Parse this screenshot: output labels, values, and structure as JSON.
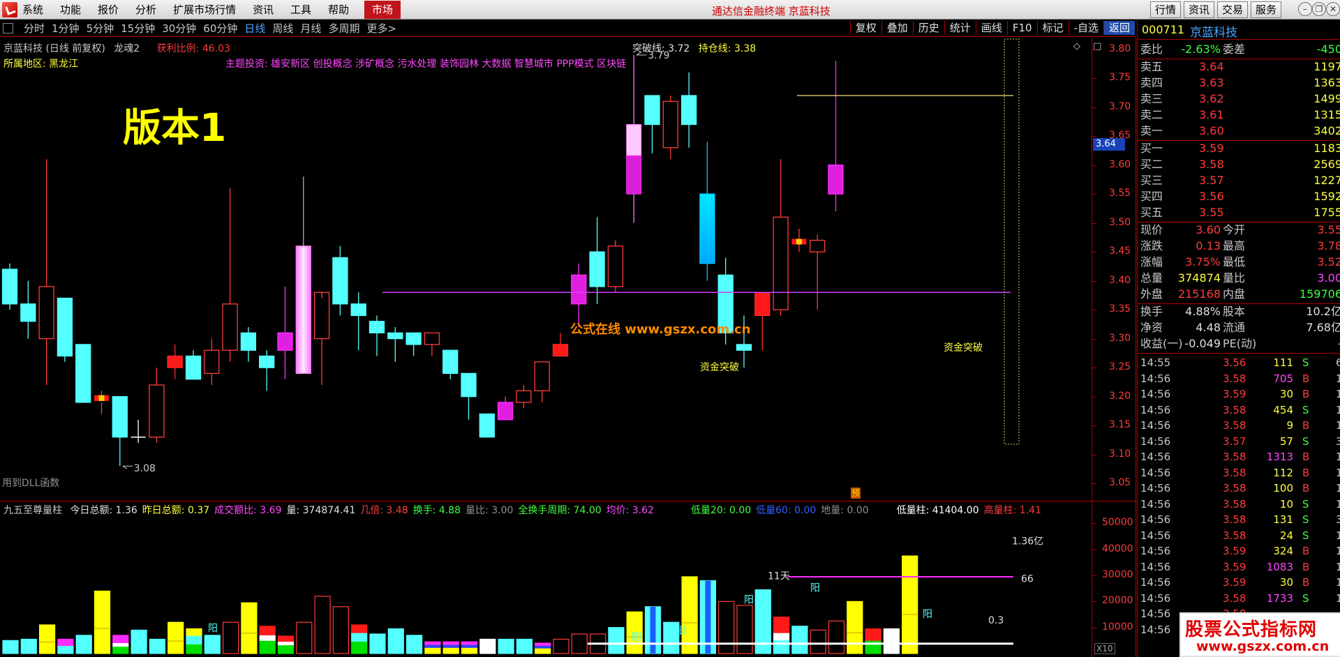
{
  "menubar": {
    "items": [
      "系统",
      "功能",
      "报价",
      "分析",
      "扩展市场行情",
      "资讯",
      "工具",
      "帮助"
    ],
    "market_tab": "市场",
    "banner": "通达信金融终端  京蓝科技",
    "right_buttons": [
      "行情",
      "资讯",
      "交易",
      "服务"
    ]
  },
  "periodbar": {
    "periods": [
      "分时",
      "1分钟",
      "5分钟",
      "15分钟",
      "30分钟",
      "60分钟",
      "日线",
      "周线",
      "月线",
      "多周期",
      "更多>"
    ],
    "active": "日线",
    "tools": [
      "复权",
      "叠加",
      "历史",
      "统计",
      "画线",
      "F10",
      "标记",
      "-自选",
      "返回"
    ]
  },
  "main": {
    "stock_info": "京蓝科技 (日线 前复权)",
    "indicator_name": "龙魂2",
    "profit_label": "获利比例: 46.03",
    "breakthrough_label": "突破线: 3.72",
    "hold_label": "持仓线: 3.38",
    "region": "所属地区: 黑龙江",
    "theme": "主题投资: 雄安新区 创投概念 涉矿概念 污水处理 装饰园林 大数据 智慧城市 PPP模式 区块链",
    "version": "版本1",
    "watermark": "公式在线  www.gszx.com.cn",
    "dll_label": "用到DLL函数",
    "annotation1": "资金突破",
    "annotation2": "资金突破",
    "pre_marker": "预",
    "current_price_tag": "3.64",
    "high_label": "3.79",
    "low_label": "3.08",
    "price_axis": [
      "3.80",
      "3.75",
      "3.70",
      "3.65",
      "3.60",
      "3.55",
      "3.50",
      "3.45",
      "3.40",
      "3.35",
      "3.30",
      "3.25",
      "3.20",
      "3.15",
      "3.10",
      "3.05"
    ]
  },
  "volume": {
    "title": "九五至尊量柱",
    "fields": [
      {
        "label": "今日总额: 1.36",
        "color": "#e0e0e0"
      },
      {
        "label": "昨日总额: 0.37",
        "color": "#ffff40"
      },
      {
        "label": "成交额比: 3.69",
        "color": "#ff4aff"
      },
      {
        "label": "量: 374874.41",
        "color": "#e0e0e0"
      },
      {
        "label": "几倍: 3.48",
        "color": "#ff3c3c"
      },
      {
        "label": "换手: 4.88",
        "color": "#40ff40"
      },
      {
        "label": "量比: 3.00",
        "color": "#909090"
      },
      {
        "label": "全换手周期: 74.00",
        "color": "#40ff40"
      },
      {
        "label": "均价: 3.62",
        "color": "#ff4aff"
      }
    ],
    "fields_right": [
      {
        "label": "低量20: 0.00",
        "color": "#40ff40"
      },
      {
        "label": "低量60: 0.00",
        "color": "#3060ff"
      },
      {
        "label": "地量: 0.00",
        "color": "#909090"
      },
      {
        "label": "低量柱: 41404.00",
        "color": "#ffffff"
      },
      {
        "label": "高量柱: 1.41",
        "color": "#ff3c3c"
      }
    ],
    "axis": [
      "50000",
      "40000",
      "30000",
      "20000",
      "10000"
    ],
    "top_label": "1.36亿",
    "label_66": "66",
    "label_11": "11天",
    "label_03": "0.3",
    "yang_label": "阳",
    "x10": "X10"
  },
  "quote": {
    "code": "000711",
    "name": "京蓝科技",
    "weibi": {
      "l": "委比",
      "v": "-2.63%",
      "l2": "委差",
      "v2": "-450"
    },
    "asks": [
      {
        "l": "卖五",
        "p": "3.64",
        "q": "1197"
      },
      {
        "l": "卖四",
        "p": "3.63",
        "q": "1363"
      },
      {
        "l": "卖三",
        "p": "3.62",
        "q": "1499"
      },
      {
        "l": "卖二",
        "p": "3.61",
        "q": "1315"
      },
      {
        "l": "卖一",
        "p": "3.60",
        "q": "3402"
      }
    ],
    "bids": [
      {
        "l": "买一",
        "p": "3.59",
        "q": "1183"
      },
      {
        "l": "买二",
        "p": "3.58",
        "q": "2569"
      },
      {
        "l": "买三",
        "p": "3.57",
        "q": "1227"
      },
      {
        "l": "买四",
        "p": "3.56",
        "q": "1592"
      },
      {
        "l": "买五",
        "p": "3.55",
        "q": "1755"
      }
    ],
    "stats1": [
      {
        "l": "现价",
        "v": "3.60",
        "l2": "今开",
        "v2": "3.55",
        "c": "#ff3c3c",
        "c2": "#ff3c3c"
      },
      {
        "l": "涨跌",
        "v": "0.13",
        "l2": "最高",
        "v2": "3.78",
        "c": "#ff3c3c",
        "c2": "#ff3c3c"
      },
      {
        "l": "涨幅",
        "v": "3.75%",
        "l2": "最低",
        "v2": "3.52",
        "c": "#ff3c3c",
        "c2": "#ff3c3c"
      },
      {
        "l": "总量",
        "v": "374874",
        "l2": "量比",
        "v2": "3.00",
        "c": "#ffff40",
        "c2": "#ff4aff"
      },
      {
        "l": "外盘",
        "v": "215168",
        "l2": "内盘",
        "v2": "159706",
        "c": "#ff3c3c",
        "c2": "#40ff40"
      }
    ],
    "stats2": [
      {
        "l": "换手",
        "v": "4.88%",
        "l2": "股本",
        "v2": "10.2亿"
      },
      {
        "l": "净资",
        "v": "4.48",
        "l2": "流通",
        "v2": "7.68亿"
      },
      {
        "l": "收益(一)",
        "v": "-0.049",
        "l2": "PE(动)",
        "v2": "-"
      }
    ],
    "ticks": [
      {
        "t": "14:55",
        "p": "3.56",
        "q": "111",
        "d": "S",
        "e": "6"
      },
      {
        "t": "14:56",
        "p": "3.58",
        "q": "705",
        "d": "B",
        "e": "1"
      },
      {
        "t": "14:56",
        "p": "3.59",
        "q": "30",
        "d": "B",
        "e": "1"
      },
      {
        "t": "14:56",
        "p": "3.58",
        "q": "454",
        "d": "S",
        "e": "1"
      },
      {
        "t": "14:56",
        "p": "3.58",
        "q": "9",
        "d": "B",
        "e": "1"
      },
      {
        "t": "14:56",
        "p": "3.57",
        "q": "57",
        "d": "S",
        "e": "3"
      },
      {
        "t": "14:56",
        "p": "3.58",
        "q": "1313",
        "d": "B",
        "e": "1"
      },
      {
        "t": "14:56",
        "p": "3.58",
        "q": "112",
        "d": "B",
        "e": "1"
      },
      {
        "t": "14:56",
        "p": "3.58",
        "q": "100",
        "d": "B",
        "e": "1"
      },
      {
        "t": "14:56",
        "p": "3.58",
        "q": "10",
        "d": "S",
        "e": "1"
      },
      {
        "t": "14:56",
        "p": "3.58",
        "q": "131",
        "d": "S",
        "e": "3"
      },
      {
        "t": "14:56",
        "p": "3.58",
        "q": "24",
        "d": "S",
        "e": "1"
      },
      {
        "t": "14:56",
        "p": "3.59",
        "q": "324",
        "d": "B",
        "e": "1"
      },
      {
        "t": "14:56",
        "p": "3.59",
        "q": "1083",
        "d": "B",
        "e": "1"
      },
      {
        "t": "14:56",
        "p": "3.59",
        "q": "30",
        "d": "B",
        "e": "1"
      },
      {
        "t": "14:56",
        "p": "3.58",
        "q": "1733",
        "d": "S",
        "e": "1"
      },
      {
        "t": "14:56",
        "p": "3.58",
        "q": "...",
        "d": "",
        "e": ""
      },
      {
        "t": "14:56",
        "p": "",
        "q": "",
        "d": "",
        "e": ""
      }
    ]
  },
  "brand": {
    "title": "股票公式指标网",
    "url": "www.gszx.com.cn"
  },
  "chart_data": {
    "type": "candlestick",
    "candles": [
      {
        "o": 3.36,
        "h": 3.43,
        "l": 3.35,
        "c": 3.42,
        "col": "cyan"
      },
      {
        "o": 3.33,
        "h": 3.4,
        "l": 3.3,
        "c": 3.36,
        "col": "cyan"
      },
      {
        "o": 3.3,
        "h": 3.61,
        "l": 3.22,
        "c": 3.39,
        "col": "red"
      },
      {
        "o": 3.37,
        "h": 3.37,
        "l": 3.26,
        "c": 3.27,
        "col": "cyan"
      },
      {
        "o": 3.29,
        "h": 3.29,
        "l": 3.2,
        "c": 3.19,
        "col": "cyan"
      },
      {
        "o": 3.2,
        "h": 3.21,
        "l": 3.17,
        "c": 3.19,
        "col": "ylw"
      },
      {
        "o": 3.2,
        "h": 3.2,
        "l": 3.08,
        "c": 3.13,
        "col": "cyan"
      },
      {
        "o": 3.13,
        "h": 3.16,
        "l": 3.12,
        "c": 3.13,
        "col": "white"
      },
      {
        "o": 3.13,
        "h": 3.25,
        "l": 3.12,
        "c": 3.22,
        "col": "red"
      },
      {
        "o": 3.27,
        "h": 3.29,
        "l": 3.23,
        "c": 3.25,
        "col": "redfill"
      },
      {
        "o": 3.27,
        "h": 3.28,
        "l": 3.23,
        "c": 3.23,
        "col": "cyan"
      },
      {
        "o": 3.24,
        "h": 3.3,
        "l": 3.22,
        "c": 3.28,
        "col": "red"
      },
      {
        "o": 3.28,
        "h": 3.56,
        "l": 3.26,
        "c": 3.36,
        "col": "red"
      },
      {
        "o": 3.31,
        "h": 3.32,
        "l": 3.26,
        "c": 3.28,
        "col": "cyan"
      },
      {
        "o": 3.27,
        "h": 3.28,
        "l": 3.21,
        "c": 3.25,
        "col": "cyan"
      },
      {
        "o": 3.28,
        "h": 3.39,
        "l": 3.23,
        "c": 3.31,
        "col": "mag"
      },
      {
        "o": 3.24,
        "h": 3.58,
        "l": 3.24,
        "c": 3.46,
        "col": "pinkgrad"
      },
      {
        "o": 3.3,
        "h": 3.37,
        "l": 3.22,
        "c": 3.38,
        "col": "red"
      },
      {
        "o": 3.44,
        "h": 3.46,
        "l": 3.34,
        "c": 3.36,
        "col": "cyan"
      },
      {
        "o": 3.36,
        "h": 3.38,
        "l": 3.28,
        "c": 3.34,
        "col": "cyan"
      },
      {
        "o": 3.33,
        "h": 3.34,
        "l": 3.27,
        "c": 3.31,
        "col": "cyan"
      },
      {
        "o": 3.31,
        "h": 3.32,
        "l": 3.26,
        "c": 3.3,
        "col": "cyan"
      },
      {
        "o": 3.31,
        "h": 3.31,
        "l": 3.27,
        "c": 3.29,
        "col": "cyan"
      },
      {
        "o": 3.29,
        "h": 3.31,
        "l": 3.27,
        "c": 3.31,
        "col": "red"
      },
      {
        "o": 3.28,
        "h": 3.28,
        "l": 3.23,
        "c": 3.24,
        "col": "cyan"
      },
      {
        "o": 3.24,
        "h": 3.24,
        "l": 3.16,
        "c": 3.2,
        "col": "cyan"
      },
      {
        "o": 3.17,
        "h": 3.17,
        "l": 3.13,
        "c": 3.13,
        "col": "cyan"
      },
      {
        "o": 3.16,
        "h": 3.2,
        "l": 3.16,
        "c": 3.19,
        "col": "mag"
      },
      {
        "o": 3.19,
        "h": 3.22,
        "l": 3.18,
        "c": 3.21,
        "col": "red"
      },
      {
        "o": 3.21,
        "h": 3.26,
        "l": 3.19,
        "c": 3.26,
        "col": "red"
      },
      {
        "o": 3.27,
        "h": 3.31,
        "l": 3.27,
        "c": 3.29,
        "col": "redfill"
      },
      {
        "o": 3.36,
        "h": 3.43,
        "l": 3.32,
        "c": 3.41,
        "col": "mag"
      },
      {
        "o": 3.39,
        "h": 3.51,
        "l": 3.36,
        "c": 3.45,
        "col": "cyan"
      },
      {
        "o": 3.39,
        "h": 3.47,
        "l": 3.38,
        "c": 3.46,
        "col": "red"
      },
      {
        "o": 3.55,
        "h": 3.79,
        "l": 3.5,
        "c": 3.67,
        "col": "pinkgrad2"
      },
      {
        "o": 3.67,
        "h": 3.72,
        "l": 3.62,
        "c": 3.72,
        "col": "cyan"
      },
      {
        "o": 3.63,
        "h": 3.72,
        "l": 3.61,
        "c": 3.71,
        "col": "red"
      },
      {
        "o": 3.72,
        "h": 3.76,
        "l": 3.63,
        "c": 3.67,
        "col": "cyan"
      },
      {
        "o": 3.55,
        "h": 3.64,
        "l": 3.4,
        "c": 3.43,
        "col": "cyanblue"
      },
      {
        "o": 3.41,
        "h": 3.44,
        "l": 3.29,
        "c": 3.31,
        "col": "cyan"
      },
      {
        "o": 3.29,
        "h": 3.34,
        "l": 3.25,
        "c": 3.28,
        "col": "cyan"
      },
      {
        "o": 3.34,
        "h": 3.38,
        "l": 3.28,
        "c": 3.38,
        "col": "redfill"
      },
      {
        "o": 3.35,
        "h": 3.61,
        "l": 3.34,
        "c": 3.51,
        "col": "red"
      },
      {
        "o": 3.47,
        "h": 3.49,
        "l": 3.45,
        "c": 3.47,
        "col": "ylw"
      },
      {
        "o": 3.47,
        "h": 3.48,
        "l": 3.35,
        "c": 3.45,
        "col": "red"
      },
      {
        "o": 3.55,
        "h": 3.78,
        "l": 3.52,
        "c": 3.6,
        "col": "mag"
      }
    ],
    "volumes": [
      {
        "v": 5000,
        "k": "cyan"
      },
      {
        "v": 5500,
        "k": "cyan"
      },
      {
        "v": 11000,
        "k": "ylw"
      },
      {
        "v": 5500,
        "k": "mix1"
      },
      {
        "v": 7000,
        "k": "cyan"
      },
      {
        "v": 24000,
        "k": "ylw"
      },
      {
        "v": 7000,
        "k": "mix2"
      },
      {
        "v": 9000,
        "k": "cyan"
      },
      {
        "v": 5500,
        "k": "cyan"
      },
      {
        "v": 12000,
        "k": "ylw"
      },
      {
        "v": 9500,
        "k": "mix3"
      },
      {
        "v": 7000,
        "k": "cyan"
      },
      {
        "v": 12000,
        "k": "red"
      },
      {
        "v": 19500,
        "k": "ylw"
      },
      {
        "v": 10500,
        "k": "mix4"
      },
      {
        "v": 6700,
        "k": "mix4"
      },
      {
        "v": 12000,
        "k": "red"
      },
      {
        "v": 22000,
        "k": "red"
      },
      {
        "v": 18000,
        "k": "red"
      },
      {
        "v": 11000,
        "k": "mix5"
      },
      {
        "v": 7500,
        "k": "cyan"
      },
      {
        "v": 9500,
        "k": "cyan"
      },
      {
        "v": 7000,
        "k": "cyan"
      },
      {
        "v": 4500,
        "k": "mix6"
      },
      {
        "v": 4500,
        "k": "mix6"
      },
      {
        "v": 4500,
        "k": "mix6"
      },
      {
        "v": 5500,
        "k": "white"
      },
      {
        "v": 5500,
        "k": "cyan"
      },
      {
        "v": 5500,
        "k": "cyan"
      },
      {
        "v": 4000,
        "k": "mix6"
      },
      {
        "v": 5500,
        "k": "red"
      },
      {
        "v": 7500,
        "k": "red"
      },
      {
        "v": 7500,
        "k": "red"
      },
      {
        "v": 10000,
        "k": "cyan"
      },
      {
        "v": 16000,
        "k": "ylw"
      },
      {
        "v": 18000,
        "k": "cyanblue"
      },
      {
        "v": 12000,
        "k": "cyan"
      },
      {
        "v": 29500,
        "k": "ylw"
      },
      {
        "v": 28000,
        "k": "cyanblue"
      },
      {
        "v": 20000,
        "k": "red"
      },
      {
        "v": 18500,
        "k": "red"
      },
      {
        "v": 24500,
        "k": "cyan"
      },
      {
        "v": 14000,
        "k": "mix7"
      },
      {
        "v": 10500,
        "k": "cyan"
      },
      {
        "v": 9000,
        "k": "red"
      },
      {
        "v": 12500,
        "k": "red"
      },
      {
        "v": 20000,
        "k": "ylw"
      },
      {
        "v": 9500,
        "k": "mix8"
      },
      {
        "v": 9500,
        "k": "white"
      },
      {
        "v": 37500,
        "k": "ylw"
      }
    ],
    "price_range": [
      3.02,
      3.82
    ],
    "volume_range": [
      0,
      52000
    ],
    "breakthrough": 3.72,
    "hold": 3.38
  }
}
